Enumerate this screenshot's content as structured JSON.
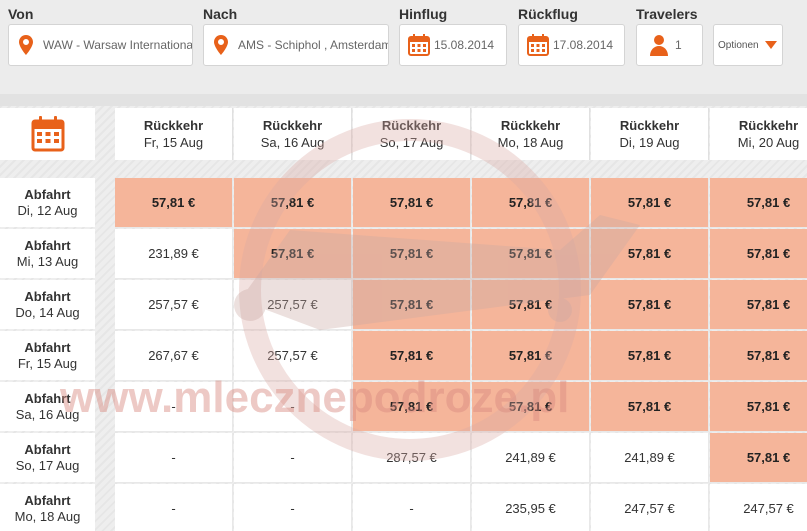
{
  "search": {
    "from_label": "Von",
    "from_value": "WAW - Warsaw International",
    "to_label": "Nach",
    "to_value": "AMS - Schiphol , Amsterdam",
    "outbound_label": "Hinflug",
    "outbound_date": "15.08.2014",
    "return_label": "Rückflug",
    "return_date": "17.08.2014",
    "travelers_label": "Travelers",
    "travelers_count": "1",
    "options_label": "Optionen"
  },
  "colors": {
    "accent": "#e8611a",
    "highlight": "#f5b59a"
  },
  "watermark_text": "www.mlecznepodroze.pl",
  "grid": {
    "columns": [
      {
        "title": "Rückkehr",
        "date": "Fr, 15 Aug"
      },
      {
        "title": "Rückkehr",
        "date": "Sa, 16 Aug"
      },
      {
        "title": "Rückkehr",
        "date": "So, 17 Aug"
      },
      {
        "title": "Rückkehr",
        "date": "Mo, 18 Aug"
      },
      {
        "title": "Rückkehr",
        "date": "Di, 19 Aug"
      },
      {
        "title": "Rückkehr",
        "date": "Mi, 20 Aug"
      }
    ],
    "rows": [
      {
        "title": "Abfahrt",
        "date": "Di, 12 Aug",
        "cells": [
          {
            "price": "57,81 €",
            "hl": true
          },
          {
            "price": "57,81 €",
            "hl": true
          },
          {
            "price": "57,81 €",
            "hl": true
          },
          {
            "price": "57,81 €",
            "hl": true
          },
          {
            "price": "57,81 €",
            "hl": true
          },
          {
            "price": "57,81 €",
            "hl": true
          }
        ]
      },
      {
        "title": "Abfahrt",
        "date": "Mi, 13 Aug",
        "cells": [
          {
            "price": "231,89 €",
            "hl": false
          },
          {
            "price": "57,81 €",
            "hl": true
          },
          {
            "price": "57,81 €",
            "hl": true
          },
          {
            "price": "57,81 €",
            "hl": true
          },
          {
            "price": "57,81 €",
            "hl": true
          },
          {
            "price": "57,81 €",
            "hl": true
          }
        ]
      },
      {
        "title": "Abfahrt",
        "date": "Do, 14 Aug",
        "cells": [
          {
            "price": "257,57 €",
            "hl": false
          },
          {
            "price": "257,57 €",
            "hl": false
          },
          {
            "price": "57,81 €",
            "hl": true
          },
          {
            "price": "57,81 €",
            "hl": true
          },
          {
            "price": "57,81 €",
            "hl": true
          },
          {
            "price": "57,81 €",
            "hl": true
          }
        ]
      },
      {
        "title": "Abfahrt",
        "date": "Fr, 15 Aug",
        "cells": [
          {
            "price": "267,67 €",
            "hl": false
          },
          {
            "price": "257,57 €",
            "hl": false
          },
          {
            "price": "57,81 €",
            "hl": true
          },
          {
            "price": "57,81 €",
            "hl": true
          },
          {
            "price": "57,81 €",
            "hl": true
          },
          {
            "price": "57,81 €",
            "hl": true
          }
        ]
      },
      {
        "title": "Abfahrt",
        "date": "Sa, 16 Aug",
        "cells": [
          {
            "price": "-",
            "hl": false
          },
          {
            "price": "-",
            "hl": false
          },
          {
            "price": "57,81 €",
            "hl": true
          },
          {
            "price": "57,81 €",
            "hl": true
          },
          {
            "price": "57,81 €",
            "hl": true
          },
          {
            "price": "57,81 €",
            "hl": true
          }
        ]
      },
      {
        "title": "Abfahrt",
        "date": "So, 17 Aug",
        "cells": [
          {
            "price": "-",
            "hl": false
          },
          {
            "price": "-",
            "hl": false
          },
          {
            "price": "287,57 €",
            "hl": false
          },
          {
            "price": "241,89 €",
            "hl": false
          },
          {
            "price": "241,89 €",
            "hl": false
          },
          {
            "price": "57,81 €",
            "hl": true
          }
        ]
      },
      {
        "title": "Abfahrt",
        "date": "Mo, 18 Aug",
        "cells": [
          {
            "price": "-",
            "hl": false
          },
          {
            "price": "-",
            "hl": false
          },
          {
            "price": "-",
            "hl": false
          },
          {
            "price": "235,95 €",
            "hl": false
          },
          {
            "price": "247,57 €",
            "hl": false
          },
          {
            "price": "247,57 €",
            "hl": false
          }
        ]
      }
    ]
  }
}
